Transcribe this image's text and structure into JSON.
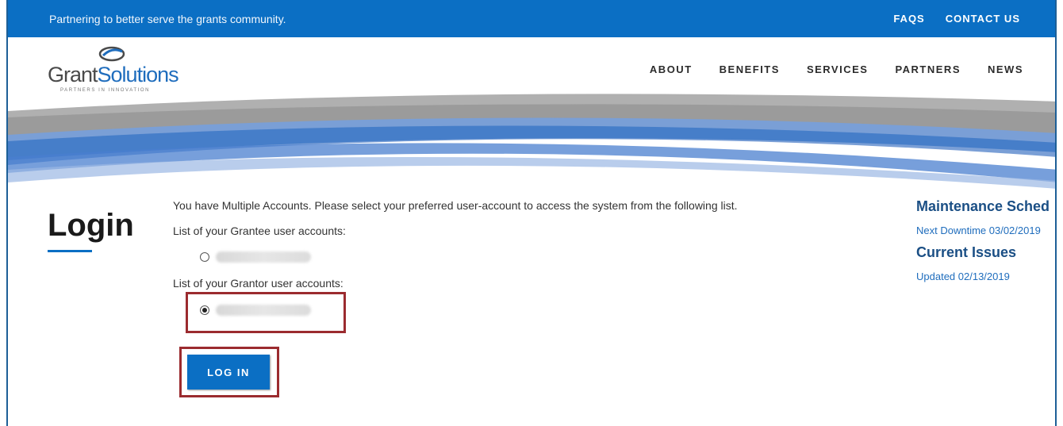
{
  "topbar": {
    "tagline": "Partnering to better serve the grants community.",
    "links": [
      "FAQS",
      "CONTACT US"
    ]
  },
  "logo": {
    "text_part1": "Grant",
    "text_part2": "Solutions",
    "tagline": "PARTNERS IN INNOVATION"
  },
  "nav": {
    "items": [
      "ABOUT",
      "BENEFITS",
      "SERVICES",
      "PARTNERS",
      "NEWS"
    ]
  },
  "page": {
    "title": "Login"
  },
  "form": {
    "instruction": "You have Multiple Accounts. Please select your preferred user-account to access the system from the following list.",
    "grantee_heading": "List of your Grantee user accounts:",
    "grantor_heading": "List of your Grantor user accounts:",
    "grantee_selected": false,
    "grantor_selected": true,
    "submit_label": "LOG IN"
  },
  "sidebar": {
    "maintenance_heading": "Maintenance Sched",
    "maintenance_link": "Next Downtime 03/02/2019",
    "issues_heading": "Current Issues",
    "issues_link": "Updated 02/13/2019"
  },
  "colors": {
    "brand_blue": "#0b6fc4",
    "highlight_red": "#9b2b2f",
    "heading_blue": "#1b4f85"
  }
}
